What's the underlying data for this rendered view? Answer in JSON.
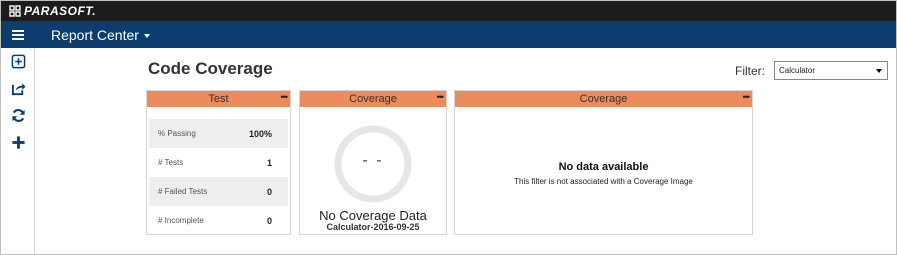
{
  "brand": {
    "name": "PARASOFT."
  },
  "navbar": {
    "app_title": "Report Center"
  },
  "sidebar": {
    "icons": [
      "add-widget-icon",
      "share-icon",
      "refresh-icon",
      "plus-icon"
    ]
  },
  "page": {
    "title": "Code Coverage",
    "filter_label": "Filter:",
    "filter_value": "Calculator"
  },
  "widgets": {
    "test": {
      "header": "Test",
      "menu": "•••",
      "rows": [
        {
          "label": "% Passing",
          "value": "100%"
        },
        {
          "label": "# Tests",
          "value": "1"
        },
        {
          "label": "# Failed Tests",
          "value": "0"
        },
        {
          "label": "# Incomplete",
          "value": "0"
        }
      ]
    },
    "coverage_gauge": {
      "header": "Coverage",
      "menu": "•••",
      "gauge_text": "- -",
      "status": "No Coverage Data",
      "subtitle": "Calculator-2016-09-25"
    },
    "coverage_chart": {
      "header": "Coverage",
      "menu": "•••",
      "empty_title": "No data available",
      "empty_message": "This filter is not associated with a Coverage Image"
    }
  },
  "colors": {
    "brandbar": "#1c1c1c",
    "navbar": "#0d3d6e",
    "widget_header": "#ec8c5c"
  }
}
